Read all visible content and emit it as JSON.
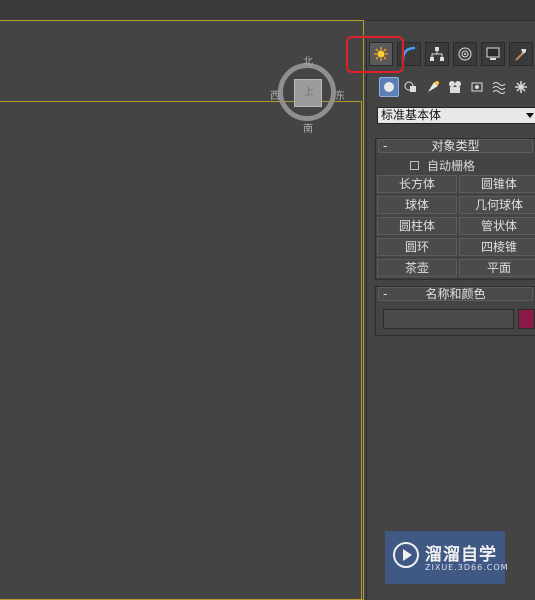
{
  "compass": {
    "north": "北",
    "south": "南",
    "east": "东",
    "west": "西",
    "cube_face": "上"
  },
  "command_panel": {
    "tabs": [
      {
        "icon": "create-icon",
        "active": true
      },
      {
        "icon": "modify-icon",
        "active": false
      },
      {
        "icon": "hierarchy-icon",
        "active": false
      },
      {
        "icon": "motion-icon",
        "active": false
      },
      {
        "icon": "display-icon",
        "active": false
      },
      {
        "icon": "utilities-icon",
        "active": false
      }
    ],
    "subtabs": [
      "geometry-icon",
      "shapes-icon",
      "lights-icon",
      "cameras-icon",
      "helpers-icon",
      "space-warps-icon",
      "systems-icon"
    ],
    "dropdown": {
      "selected": "标准基本体"
    },
    "object_type": {
      "header": "对象类型",
      "collapse": "-",
      "autogrid_label": "自动栅格",
      "buttons": [
        "长方体",
        "圆锥体",
        "球体",
        "几何球体",
        "圆柱体",
        "管状体",
        "圆环",
        "四棱锥",
        "茶壶",
        "平面"
      ]
    },
    "name_color": {
      "header": "名称和颜色",
      "collapse": "-",
      "name_value": "",
      "color": "#8a1a46"
    }
  },
  "watermark": {
    "title": "溜溜自学",
    "url": "ZIXUE.3D66.COM"
  },
  "colors": {
    "highlight": "#e0202a",
    "viewport_border": "#b49a2a",
    "active_subtab": "#5b80b8"
  }
}
